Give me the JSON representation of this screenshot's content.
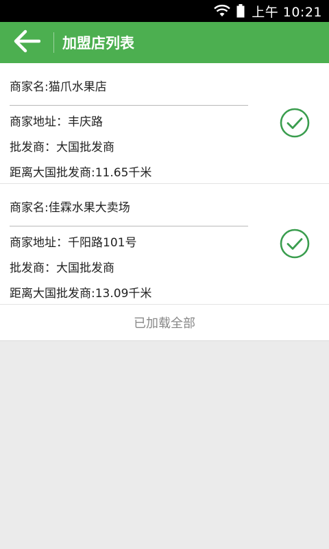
{
  "status_bar": {
    "time": "上午 10:21",
    "icons": [
      "wifi-icon",
      "battery-icon"
    ]
  },
  "app_bar": {
    "title": "加盟店列表",
    "back_icon": "arrow-left-icon",
    "color": "#4caf50"
  },
  "stores": [
    {
      "name": "商家名:猫爪水果店",
      "address": "商家地址：丰庆路",
      "wholesaler": "批发商：大国批发商",
      "distance": "距离大国批发商:11.65千米",
      "checked": true
    },
    {
      "name": "商家名:佳霖水果大卖场",
      "address": "商家地址：千阳路101号",
      "wholesaler": "批发商：大国批发商",
      "distance": "距离大国批发商:13.09千米",
      "checked": true
    }
  ],
  "footer": {
    "loaded_all": "已加载全部"
  },
  "colors": {
    "accent": "#4caf50",
    "check": "#3a9d4e",
    "background": "#ebebeb"
  }
}
